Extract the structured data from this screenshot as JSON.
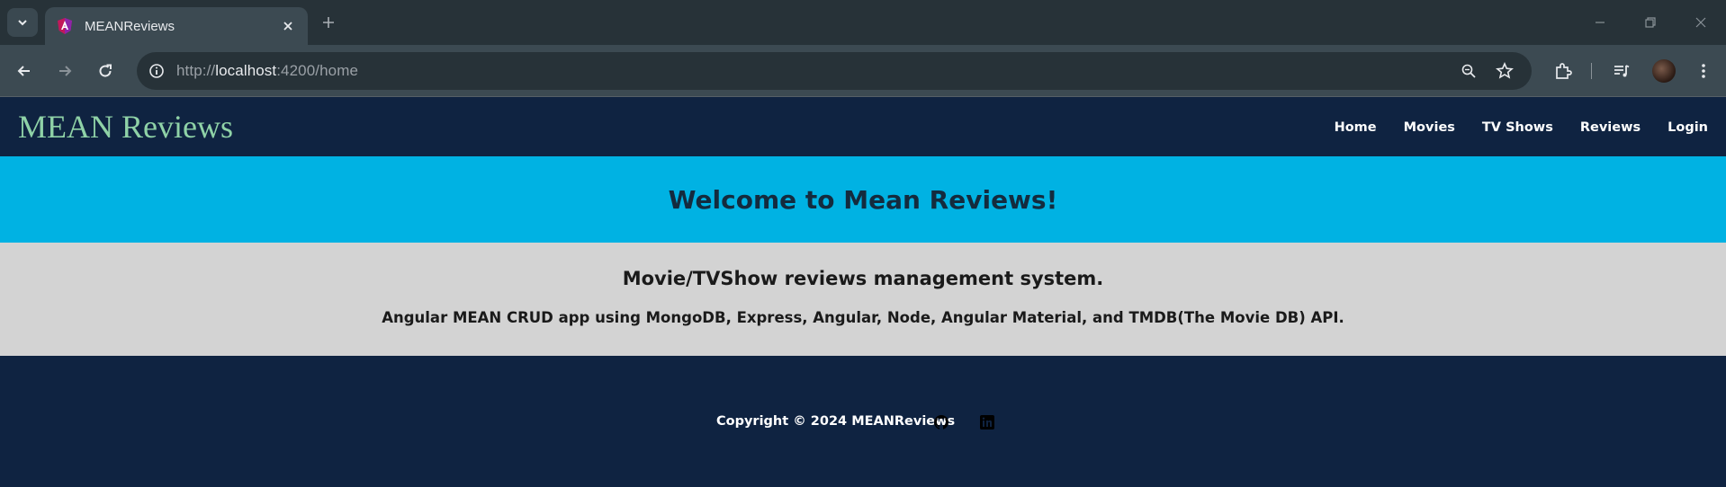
{
  "browser": {
    "tab_title": "MEANReviews",
    "url_scheme": "http://",
    "url_host": "localhost",
    "url_rest": ":4200/home",
    "icons": [
      "tab-search-icon",
      "close-icon",
      "plus-icon",
      "minimize-icon",
      "restore-icon",
      "window-close-icon",
      "back-icon",
      "forward-icon",
      "reload-icon",
      "info-icon",
      "zoom-icon",
      "star-icon",
      "extensions-icon",
      "reading-list-icon"
    ]
  },
  "header": {
    "brand": "MEAN Reviews",
    "nav": [
      "Home",
      "Movies",
      "TV Shows",
      "Reviews",
      "Login"
    ]
  },
  "hero": {
    "title": "Welcome to Mean Reviews!"
  },
  "about": {
    "heading": "Movie/TVShow reviews management system.",
    "description": "Angular MEAN CRUD app using MongoDB, Express, Angular, Node, Angular Material, and TMDB(The Movie DB) API."
  },
  "footer": {
    "copyright": "Copyright © 2024 MEANReviews",
    "social": [
      "github-icon",
      "linkedin-icon"
    ]
  },
  "colors": {
    "header_bg": "#0f2341",
    "brand": "#8fd2a7",
    "hero_bg": "#00b2e3",
    "about_bg": "#d3d3d3"
  }
}
